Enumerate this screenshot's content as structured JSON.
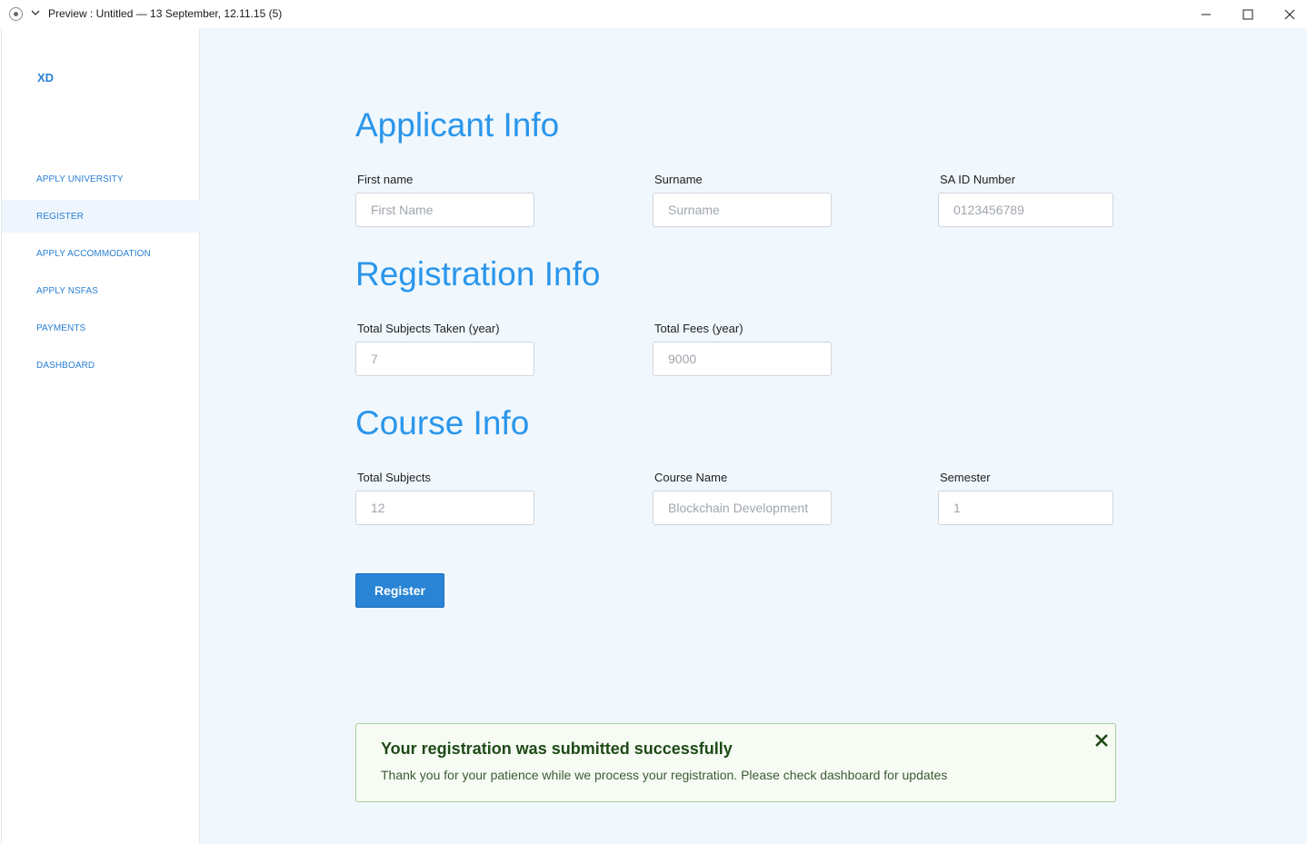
{
  "window": {
    "title": "Preview : Untitled — 13 September, 12.11.15 (5)"
  },
  "sidebar": {
    "logo": "XD",
    "items": [
      {
        "label": "APPLY UNIVERSITY"
      },
      {
        "label": "REGISTER"
      },
      {
        "label": "APPLY ACCOMMODATION"
      },
      {
        "label": "APPLY NSFAS"
      },
      {
        "label": "PAYMENTS"
      },
      {
        "label": "DASHBOARD"
      }
    ]
  },
  "applicant": {
    "title": "Applicant Info",
    "first_name": {
      "label": "First name",
      "placeholder": "First Name"
    },
    "surname": {
      "label": "Surname",
      "placeholder": "Surname"
    },
    "id_number": {
      "label": "SA ID Number",
      "placeholder": "0123456789"
    }
  },
  "registration": {
    "title": "Registration Info",
    "subjects": {
      "label": "Total Subjects Taken (year)",
      "placeholder": "7"
    },
    "fees": {
      "label": "Total Fees (year)",
      "placeholder": "9000"
    }
  },
  "course": {
    "title": "Course Info",
    "total_subjects": {
      "label": "Total Subjects",
      "placeholder": "12"
    },
    "course_name": {
      "label": "Course Name",
      "placeholder": "Blockchain Development"
    },
    "semester": {
      "label": "Semester",
      "placeholder": "1"
    }
  },
  "actions": {
    "register_label": "Register"
  },
  "alert": {
    "title": "Your registration was submitted successfully",
    "message": "Thank you for your patience while we process your registration. Please check dashboard for updates"
  },
  "colors": {
    "accent": "#2a96ec",
    "button": "#2984d6",
    "success_bg": "#f6fcf4",
    "success_border": "#a9cf9a"
  }
}
